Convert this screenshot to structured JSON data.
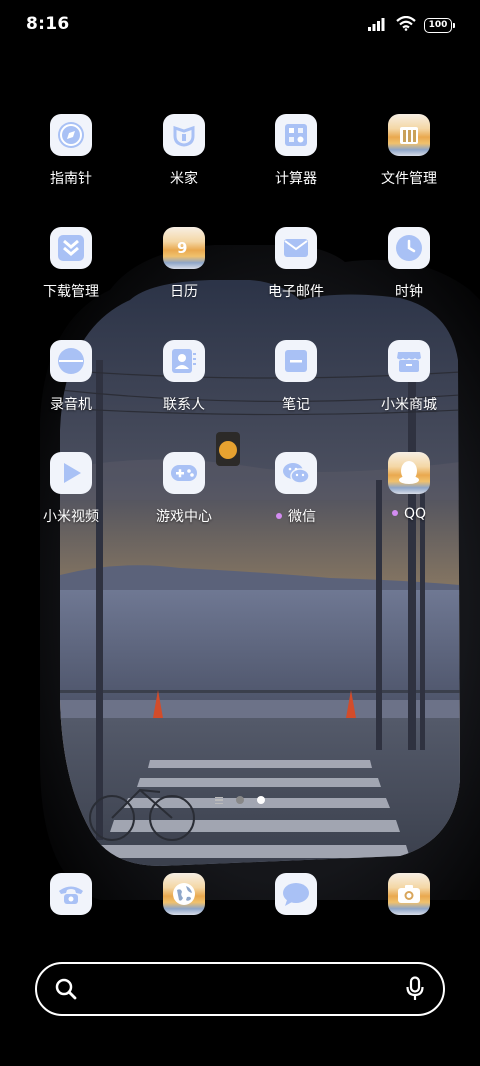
{
  "status_bar": {
    "time": "8:16",
    "battery": "100"
  },
  "apps": [
    {
      "id": "compass",
      "label": "指南针",
      "icon": "compass-icon",
      "dot": false
    },
    {
      "id": "mijia",
      "label": "米家",
      "icon": "mijia-icon",
      "dot": false
    },
    {
      "id": "calculator",
      "label": "计算器",
      "icon": "calculator-icon",
      "dot": false
    },
    {
      "id": "files",
      "label": "文件管理",
      "icon": "folder-icon",
      "dot": false
    },
    {
      "id": "downloads",
      "label": "下载管理",
      "icon": "download-icon",
      "dot": false
    },
    {
      "id": "calendar",
      "label": "日历",
      "icon": "calendar-icon",
      "dot": false
    },
    {
      "id": "email",
      "label": "电子邮件",
      "icon": "mail-icon",
      "dot": false
    },
    {
      "id": "clock",
      "label": "时钟",
      "icon": "clock-icon",
      "dot": false
    },
    {
      "id": "recorder",
      "label": "录音机",
      "icon": "recorder-icon",
      "dot": false
    },
    {
      "id": "contacts",
      "label": "联系人",
      "icon": "contacts-icon",
      "dot": false
    },
    {
      "id": "notes",
      "label": "笔记",
      "icon": "notes-icon",
      "dot": false
    },
    {
      "id": "mistore",
      "label": "小米商城",
      "icon": "store-icon",
      "dot": false
    },
    {
      "id": "video",
      "label": "小米视频",
      "icon": "play-icon",
      "dot": false
    },
    {
      "id": "gamecenter",
      "label": "游戏中心",
      "icon": "gamepad-icon",
      "dot": false
    },
    {
      "id": "wechat",
      "label": "微信",
      "icon": "wechat-icon",
      "dot": true
    },
    {
      "id": "qq",
      "label": "QQ",
      "icon": "qq-penguin-icon",
      "dot": true
    }
  ],
  "dock": [
    {
      "id": "phone",
      "icon": "phone-icon"
    },
    {
      "id": "browser",
      "icon": "browser-globe-icon"
    },
    {
      "id": "messages",
      "icon": "message-icon"
    },
    {
      "id": "camera",
      "icon": "camera-icon"
    }
  ],
  "pager": {
    "pages": 2,
    "active": 2
  },
  "search": {
    "placeholder": ""
  },
  "colors": {
    "icon_accent": "#a9c1f5",
    "icon_bg": "#f1f4fb",
    "notification_dot": "#d38cf1"
  }
}
